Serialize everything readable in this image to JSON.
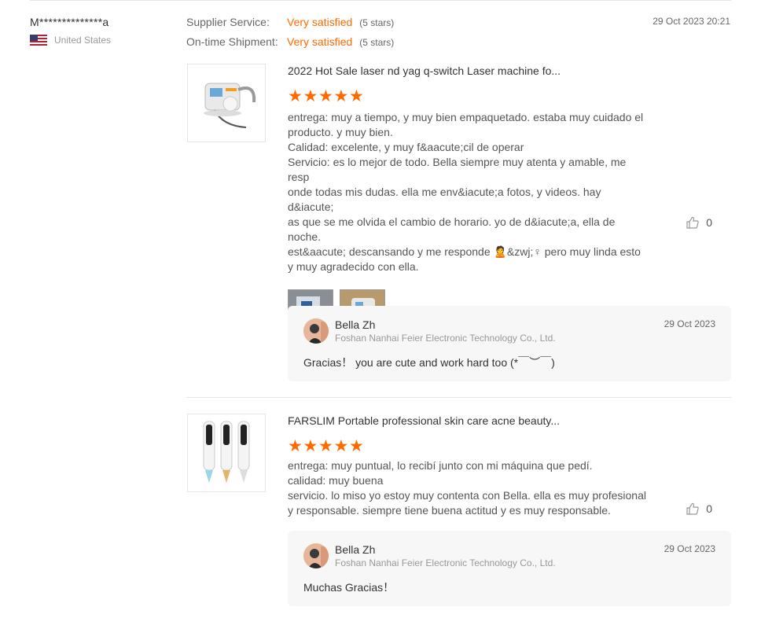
{
  "reviewer": {
    "name": "M**************a",
    "country": "United States"
  },
  "ratings": {
    "supplier_label": "Supplier Service:",
    "supplier_value": "Very satisfied",
    "supplier_stars": "(5 stars)",
    "shipment_label": "On-time Shipment:",
    "shipment_value": "Very satisfied",
    "shipment_stars": "(5 stars)"
  },
  "review_date": "29 Oct 2023 20:21",
  "colors": {
    "accent": "#ff6a00",
    "reply_bg": "#f7f7f7"
  },
  "products": [
    {
      "title": "2022 Hot Sale laser nd yag q-switch Laser machine fo...",
      "star_rating": 5,
      "text": "entrega: muy a tiempo, y muy bien empaquetado. estaba muy cuidado el\nproducto. y muy bien.\nCalidad: excelente, y muy f&aacute;cil de operar\nServicio: es lo mejor de todo. Bella siempre muy atenta y amable, me resp\nonde todas mis dudas. ella me env&iacute;a fotos, y videos. hay d&iacute;\nas que se me olvida el cambio de horario. yo de d&iacute;a, ella de noche.\nest&aacute; descansando y me responde 🙎&zwj;♀ pero muy linda esto\ny muy agradecido con ella.",
      "likes": "0",
      "reply": {
        "name": "Bella Zh",
        "company": "Foshan Nanhai Feier Electronic Technology Co., Ltd.",
        "date": "29 Oct 2023",
        "text": "Gracias！ you are cute and work hard too (*￣︶￣)"
      }
    },
    {
      "title": "FARSLIM Portable professional skin care acne beauty...",
      "star_rating": 5,
      "text": "entrega: muy puntual, lo recibí junto con mi máquina que pedí.\ncalidad: muy buena\nservicio. lo miso yo estoy muy contenta con Bella. ella es muy profesional\ny responsable. siempre tiene buena actitud y es muy responsable.",
      "likes": "0",
      "reply": {
        "name": "Bella Zh",
        "company": "Foshan Nanhai Feier Electronic Technology Co., Ltd.",
        "date": "29 Oct 2023",
        "text": "Muchas Gracias！"
      }
    }
  ]
}
